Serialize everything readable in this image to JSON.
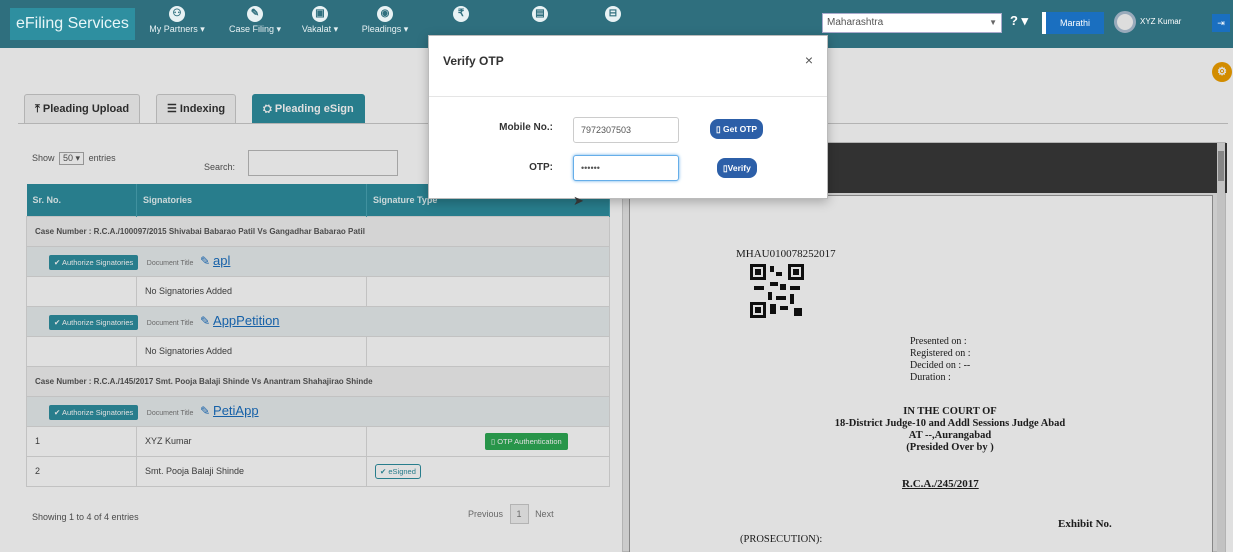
{
  "header": {
    "brand": "eFiling Services",
    "nav": [
      {
        "icon": "handshake-icon",
        "glyph": "⚇",
        "label": "My Partners ▾"
      },
      {
        "icon": "pencil-icon",
        "glyph": "✎",
        "label": "Case Filing ▾"
      },
      {
        "icon": "vakalat-icon",
        "glyph": "▣",
        "label": "Vakalat ▾"
      },
      {
        "icon": "pleadings-icon",
        "glyph": "◉",
        "label": "Pleadings ▾"
      },
      {
        "icon": "rupee-icon",
        "glyph": "₹",
        "label": ""
      },
      {
        "icon": "document-icon",
        "glyph": "▤",
        "label": ""
      },
      {
        "icon": "bag-icon",
        "glyph": "⊟",
        "label": ""
      }
    ],
    "state_value": "Maharashtra",
    "help_label": "? ▾",
    "language_label": "Marathi",
    "user_name": "XYZ Kumar"
  },
  "tabs": [
    {
      "label": "⤒ Pleading Upload",
      "active": false
    },
    {
      "label": "☰ Indexing",
      "active": false
    },
    {
      "label": "⛭ Pleading eSign",
      "active": true
    }
  ],
  "table_controls": {
    "show_prefix": "Show",
    "show_value": "50 ▾",
    "show_suffix": "entries",
    "search_label": "Search:"
  },
  "table": {
    "headers": [
      "Sr. No.",
      "Signatories",
      "Signature Type"
    ],
    "case1": "Case Number : R.C.A./100097/2015 Shivabai Babarao Patil Vs Gangadhar Babarao Patil",
    "case2": "Case Number : R.C.A./145/2017 Smt. Pooja Balaji Shinde Vs Anantram Shahajirao Shinde",
    "authorize_label": "✔ Authorize Signatories",
    "doc_title_label": "Document Title",
    "docs": [
      "apl",
      "AppPetition",
      "PetiApp"
    ],
    "no_signatories": "No Signatories Added",
    "rows": [
      {
        "sr": "1",
        "name": "XYZ Kumar",
        "action": "▯ OTP Authentication"
      },
      {
        "sr": "2",
        "name": "Smt. Pooja Balaji Shinde",
        "action": "✔ eSigned"
      }
    ]
  },
  "footer": {
    "showing": "Showing 1 to 4 of 4 entries",
    "previous": "Previous",
    "page": "1",
    "next": "Next"
  },
  "document": {
    "doc_id": "MHAU010078252017",
    "meta": [
      "Presented on   :",
      "Registered on  :",
      "Decided on     : --",
      "Duration         :"
    ],
    "court": [
      "IN THE COURT OF",
      "18-District Judge-10 and Addl Sessions Judge Abad",
      "AT --,Aurangabad",
      "(Presided Over by )"
    ],
    "case_no": "R.C.A./245/2017",
    "exhibit": "Exhibit No.",
    "prosecution": "(PROSECUTION):"
  },
  "modal": {
    "title": "Verify OTP",
    "close": "×",
    "mobile_label": "Mobile No.:",
    "mobile_value": "7972307503",
    "get_otp_label": "▯ Get OTP",
    "otp_label": "OTP:",
    "otp_value": "••••••",
    "verify_label": "▯Verify"
  }
}
